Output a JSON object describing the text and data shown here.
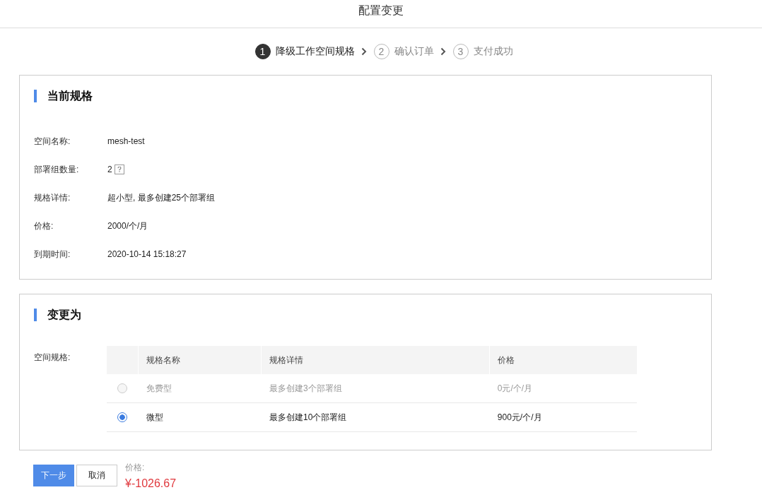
{
  "header": {
    "title": "配置变更"
  },
  "steps": [
    {
      "number": "1",
      "label": "降级工作空间规格",
      "selected": true
    },
    {
      "number": "2",
      "label": "确认订单",
      "selected": false
    },
    {
      "number": "3",
      "label": "支付成功",
      "selected": false
    }
  ],
  "current_spec": {
    "title": "当前规格",
    "fields": [
      {
        "label": "空间名称:",
        "value": "mesh-test"
      },
      {
        "label": "部署组数量:",
        "value": "2",
        "help": true
      },
      {
        "label": "规格详情:",
        "value": "超小型, 最多创建25个部署组"
      },
      {
        "label": "价格:",
        "value": "2000/个/月"
      },
      {
        "label": "到期时间:",
        "value": "2020-10-14 15:18:27"
      }
    ]
  },
  "change_to": {
    "title": "变更为",
    "label": "空间规格:",
    "table": {
      "columns": [
        "规格名称",
        "规格详情",
        "价格"
      ],
      "rows": [
        {
          "cells": [
            "免费型",
            "最多创建3个部署组",
            "0元/个/月"
          ],
          "selected": false,
          "disabled": true
        },
        {
          "cells": [
            "微型",
            "最多创建10个部署组",
            "900元/个/月"
          ],
          "selected": true,
          "disabled": false
        }
      ]
    }
  },
  "footer": {
    "next_button": "下一步",
    "cancel_button": "取消",
    "price_label": "价格:",
    "price": "¥-1026.67"
  }
}
